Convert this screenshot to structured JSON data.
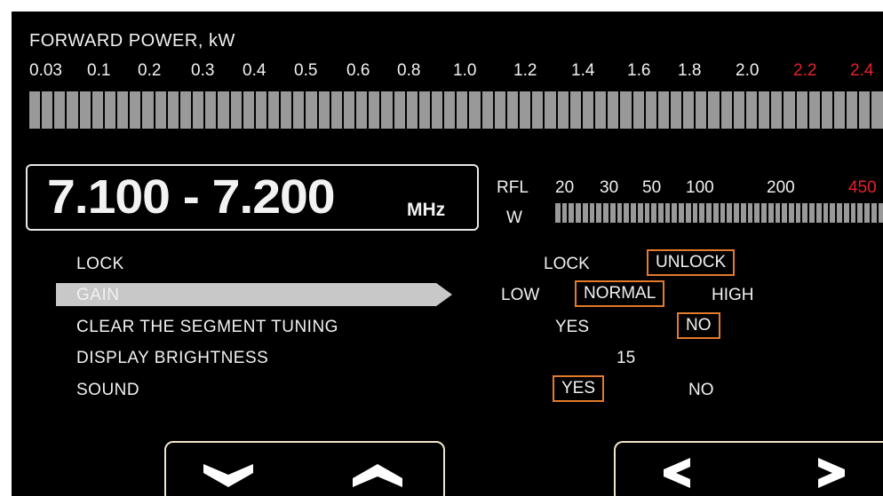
{
  "forward_power": {
    "title": "FORWARD POWER, kW",
    "ticks": [
      {
        "label": "0.03",
        "color": "#f2f2f2"
      },
      {
        "label": "0.1",
        "color": "#f2f2f2"
      },
      {
        "label": "0.2",
        "color": "#f2f2f2"
      },
      {
        "label": "0.3",
        "color": "#f2f2f2"
      },
      {
        "label": "0.4",
        "color": "#f2f2f2"
      },
      {
        "label": "0.5",
        "color": "#f2f2f2"
      },
      {
        "label": "0.6",
        "color": "#f2f2f2"
      },
      {
        "label": "0.8",
        "color": "#f2f2f2"
      },
      {
        "label": "1.0",
        "color": "#f2f2f2"
      },
      {
        "label": "1.2",
        "color": "#f2f2f2"
      },
      {
        "label": "1.4",
        "color": "#f2f2f2"
      },
      {
        "label": "1.6",
        "color": "#f2f2f2"
      },
      {
        "label": "1.8",
        "color": "#f2f2f2"
      },
      {
        "label": "2.0",
        "color": "#f2f2f2"
      },
      {
        "label": "2.2",
        "color": "#e8202a"
      },
      {
        "label": "2.4",
        "color": "#e8202a"
      }
    ],
    "level": 0
  },
  "frequency": {
    "range": "7.100 - 7.200",
    "unit": "MHz"
  },
  "reflected_power": {
    "label": "RFL",
    "unit": "W",
    "ticks": [
      {
        "label": "20",
        "color": "#f2f2f2"
      },
      {
        "label": "30",
        "color": "#f2f2f2"
      },
      {
        "label": "50",
        "color": "#f2f2f2"
      },
      {
        "label": "100",
        "color": "#f2f2f2"
      },
      {
        "label": "200",
        "color": "#f2f2f2"
      },
      {
        "label": "450",
        "color": "#e8202a"
      }
    ],
    "level": 0
  },
  "menu": {
    "selected_index": 1,
    "items": [
      {
        "label": "LOCK",
        "options": [
          "LOCK",
          "UNLOCK"
        ],
        "selected": "UNLOCK"
      },
      {
        "label": "GAIN",
        "options": [
          "LOW",
          "NORMAL",
          "HIGH"
        ],
        "selected": "NORMAL"
      },
      {
        "label": "CLEAR THE SEGMENT TUNING",
        "options": [
          "YES",
          "NO"
        ],
        "selected": "NO"
      },
      {
        "label": "DISPLAY BRIGHTNESS",
        "value": "15"
      },
      {
        "label": "SOUND",
        "options": [
          "YES",
          "NO"
        ],
        "selected": "YES"
      }
    ]
  },
  "navigation": {
    "up_down": [
      "chevron-down-icon",
      "chevron-up-icon"
    ],
    "left_right": [
      "chevron-left-icon",
      "chevron-right-icon"
    ]
  },
  "colors": {
    "background": "#000000",
    "text": "#f2f2f2",
    "warning": "#e8202a",
    "selection_border": "#e37a2c",
    "meter_segment": "#999999",
    "menu_highlight": "#c8c8c8",
    "nav_border": "#f0e6c8"
  }
}
